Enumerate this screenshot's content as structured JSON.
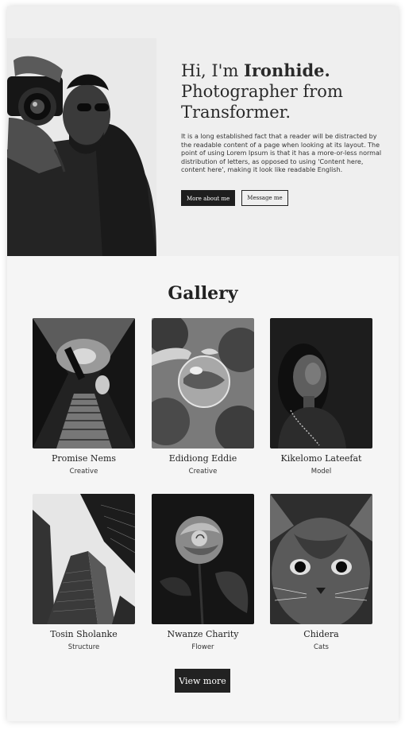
{
  "hero": {
    "greeting": "Hi, I'm ",
    "name": "Ironhide.",
    "line2": "Photographer from",
    "line3": "Transformer.",
    "description": "It is a long established fact that a reader will be distracted by the readable content of a page when looking at its layout. The point of using Lorem Ipsum is that it has a more-or-less normal distribution of letters, as opposed to using 'Content here, content here', making it look like readable English.",
    "about_button": "More about me",
    "message_button": "Message me"
  },
  "gallery": {
    "title": "Gallery",
    "items": [
      {
        "name": "Promise Nems",
        "role": "Creative"
      },
      {
        "name": "Edidiong Eddie",
        "role": "Creative"
      },
      {
        "name": "Kikelomo Lateefat",
        "role": "Model"
      },
      {
        "name": "Tosin Sholanke",
        "role": "Structure"
      },
      {
        "name": "Nwanze Charity",
        "role": "Flower"
      },
      {
        "name": "Chidera",
        "role": "Cats"
      }
    ],
    "view_more": "View more"
  },
  "colors": {
    "dark_button": "#1e1e1e",
    "page_background": "#f5f5f5"
  }
}
